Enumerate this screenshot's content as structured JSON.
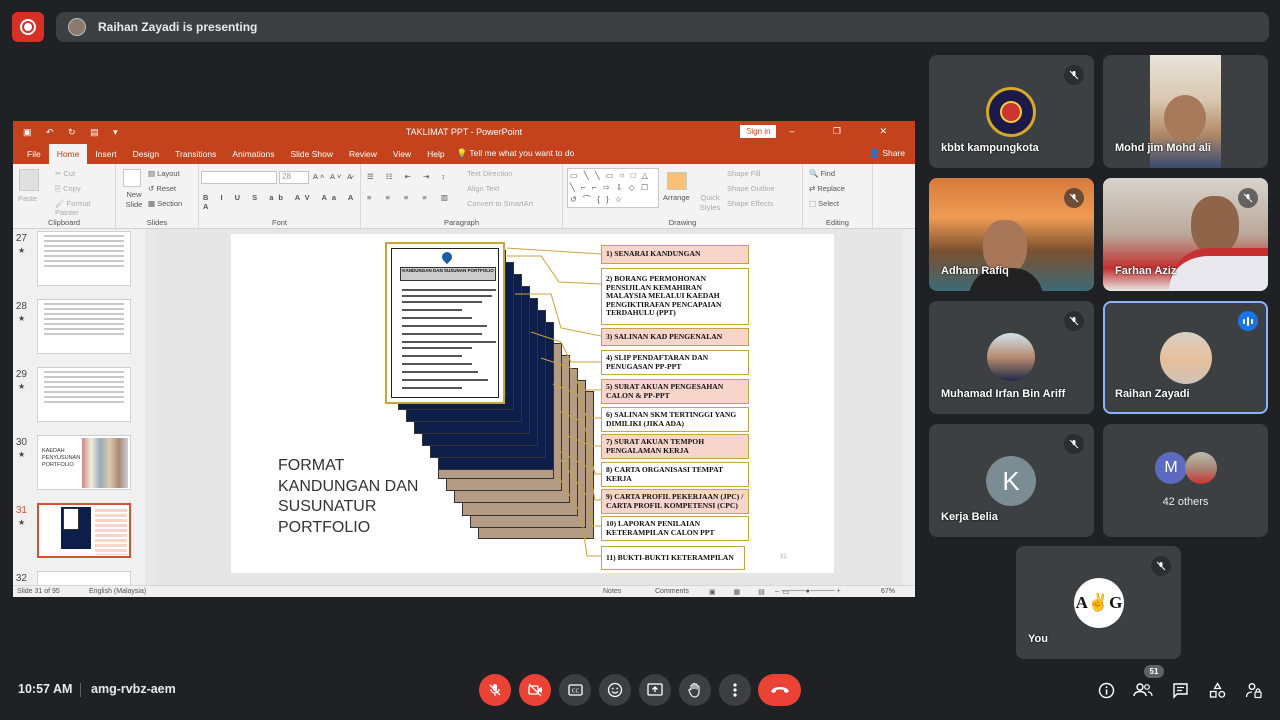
{
  "topbar": {
    "presenting_text": "Raihan Zayadi is presenting"
  },
  "ppt": {
    "window_title": "TAKLIMAT PPT  -  PowerPoint",
    "signin": "Sign in",
    "tabs": [
      "File",
      "Home",
      "Insert",
      "Design",
      "Transitions",
      "Animations",
      "Slide Show",
      "Review",
      "View",
      "Help"
    ],
    "active_tab": "Home",
    "tell_me": "Tell me what you want to do",
    "share": "Share",
    "ribbon": {
      "clipboard": {
        "label": "Clipboard",
        "paste": "Paste",
        "cut": "Cut",
        "copy": "Copy",
        "format_painter": "Format Painter"
      },
      "slides": {
        "label": "Slides",
        "new_slide": "New Slide",
        "layout": "Layout",
        "reset": "Reset",
        "section": "Section"
      },
      "font": {
        "label": "Font",
        "size": "28"
      },
      "paragraph": {
        "label": "Paragraph",
        "text_direction": "Text Direction",
        "align_text": "Align Text",
        "convert": "Convert to SmartArt"
      },
      "drawing": {
        "label": "Drawing",
        "arrange": "Arrange",
        "quick_styles": "Quick Styles",
        "shape_fill": "Shape Fill",
        "shape_outline": "Shape Outline",
        "shape_effects": "Shape Effects"
      },
      "editing": {
        "label": "Editing",
        "find": "Find",
        "replace": "Replace",
        "select": "Select"
      }
    },
    "thumbnails": [
      {
        "num": "27",
        "star": "★"
      },
      {
        "num": "28",
        "star": "★"
      },
      {
        "num": "29",
        "star": "★"
      },
      {
        "num": "30",
        "star": "★",
        "text": "KAEDAH PENYUSUNAN PORTFOLIO"
      },
      {
        "num": "31",
        "star": "★"
      },
      {
        "num": "32"
      }
    ],
    "slide": {
      "doc_title": "KANDUNGAN DAN SUSUNAN PORTFOLIO",
      "big_text": [
        "FORMAT",
        "KANDUNGAN DAN",
        "SUSUNATUR",
        "PORTFOLIO"
      ],
      "slide_number": "31",
      "labels": [
        "1) SENARAI KANDUNGAN",
        "2) BORANG PERMOHONAN PENSIJILAN KEMAHIRAN MALAYSIA MELALUI KAEDAH PENGIKTIRAFAN PENCAPAIAN TERDAHULU (PPT)",
        "3) SALINAN KAD PENGENALAN",
        "4) SLIP PENDAFTARAN DAN PENUGASAN PP-PPT",
        "5) SURAT AKUAN PENGESAHAN CALON & PP-PPT",
        "6) SALINAN SKM TERTINGGI YANG DIMILIKI (JIKA ADA)",
        "7) SURAT AKUAN TEMPOH PENGALAMAN KERJA",
        "8) CARTA ORGANISASI TEMPAT KERJA",
        "9) CARTA PROFIL PEKERJAAN (JPC) / CARTA PROFIL KOMPETENSI (CPC)",
        "10) LAPORAN PENILAIAN KETERAMPILAN CALON PPT",
        "11) BUKTI-BUKTI KETERAMPILAN"
      ]
    },
    "status": {
      "slide_of": "Slide 31 of 95",
      "language": "English (Malaysia)",
      "notes": "Notes",
      "comments": "Comments",
      "zoom": "67%"
    }
  },
  "participants": [
    {
      "name": "kbbt kampungkota"
    },
    {
      "name": "Mohd jim Mohd ali"
    },
    {
      "name": "Adham Rafiq"
    },
    {
      "name": "Farhan Aziz"
    },
    {
      "name": "Muhamad Irfan Bin Ariff"
    },
    {
      "name": "Raihan Zayadi"
    },
    {
      "name": "Kerja Belia",
      "initial": "K"
    },
    {
      "others": "42 others",
      "initial": "M"
    },
    {
      "name": "You"
    }
  ],
  "bottom": {
    "time": "10:57 AM",
    "meeting_code": "amg-rvbz-aem",
    "people_count": "51"
  },
  "colors": {
    "accent_red": "#ea4335",
    "ppt_orange": "#c5431c",
    "tile_bg": "#3c4043",
    "speaking_border": "#8ab4f8"
  }
}
